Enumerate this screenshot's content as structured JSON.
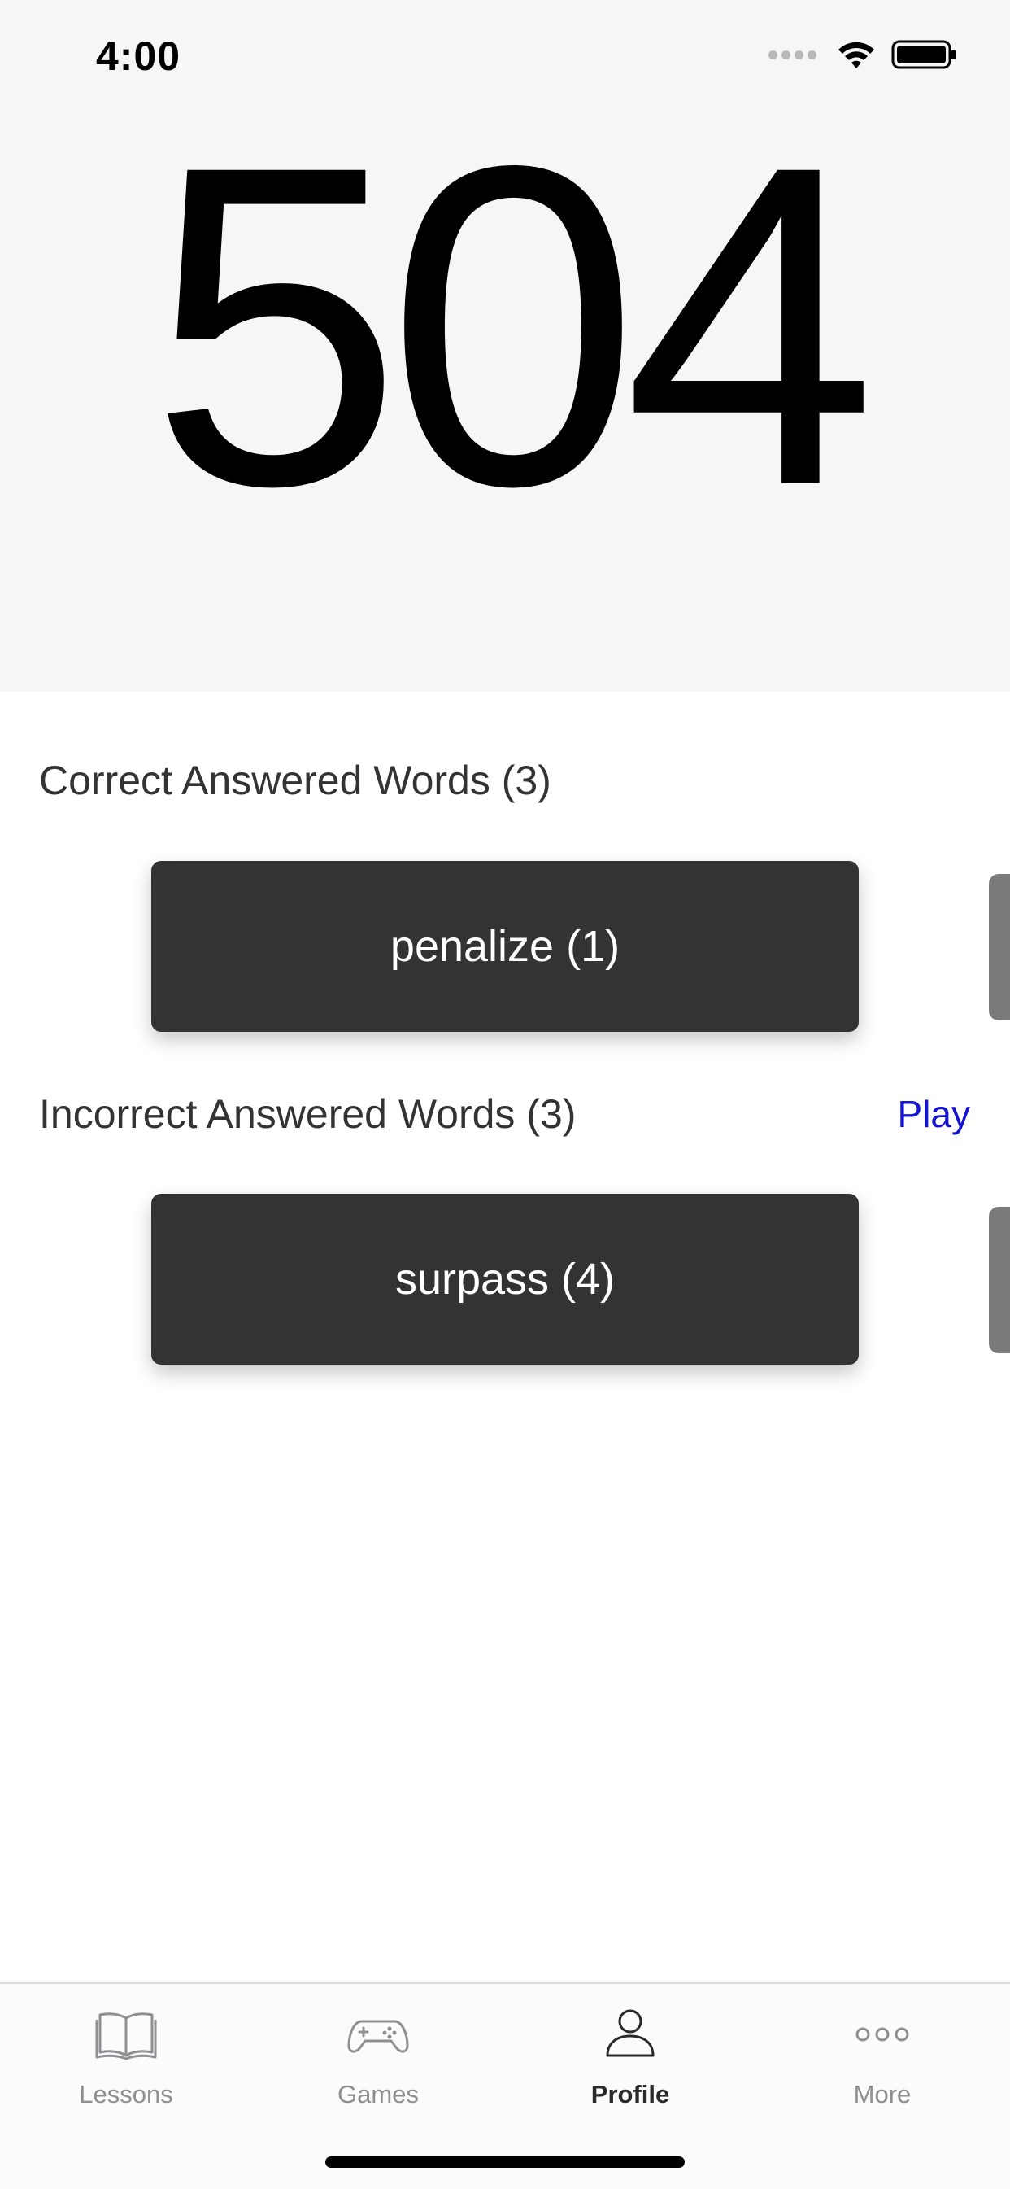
{
  "status_bar": {
    "time": "4:00",
    "icons": [
      "signal-dots-icon",
      "wifi-icon",
      "battery-icon"
    ]
  },
  "score": {
    "value": "504"
  },
  "correct_section": {
    "title": "Correct Answered Words (3)",
    "cards": [
      {
        "label": "penalize (1)"
      }
    ]
  },
  "incorrect_section": {
    "title": "Incorrect Answered Words (3)",
    "play_label": "Play",
    "cards": [
      {
        "label": "surpass (4)"
      }
    ]
  },
  "tab_bar": {
    "tabs": [
      {
        "label": "Lessons",
        "icon": "book-icon"
      },
      {
        "label": "Games",
        "icon": "gamepad-icon"
      },
      {
        "label": "Profile",
        "icon": "person-icon",
        "active": true
      },
      {
        "label": "More",
        "icon": "more-dots-icon"
      }
    ]
  },
  "colors": {
    "header_bg": "#f6f6f6",
    "card_bg": "#333333",
    "link": "#1414d2",
    "tab_inactive": "#8e8e93"
  }
}
